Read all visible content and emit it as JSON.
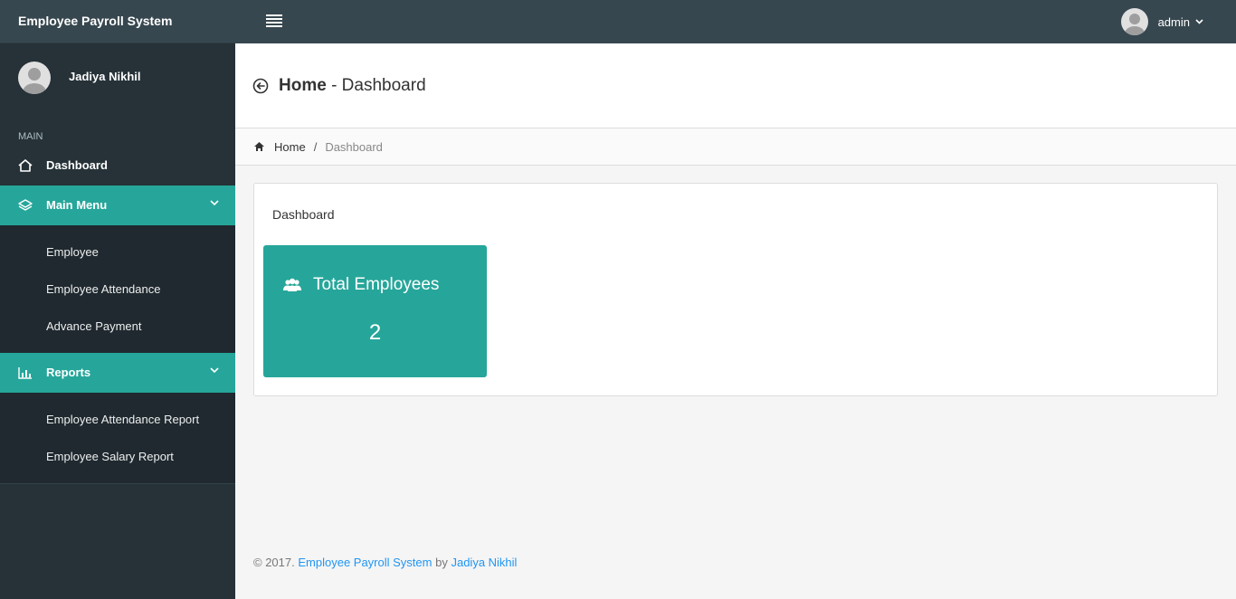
{
  "navbar": {
    "brand": "Employee Payroll System",
    "user_name": "admin"
  },
  "sidebar": {
    "user_name": "Jadiya Nikhil",
    "category": "MAIN",
    "dashboard": "Dashboard",
    "main_menu": {
      "label": "Main Menu",
      "items": [
        "Employee",
        "Employee Attendance",
        "Advance Payment"
      ]
    },
    "reports": {
      "label": "Reports",
      "items": [
        "Employee Attendance Report",
        "Employee Salary Report"
      ]
    }
  },
  "header": {
    "title": "Home",
    "subtitle": "- Dashboard"
  },
  "breadcrumb": {
    "home": "Home",
    "separator": "/",
    "current": "Dashboard"
  },
  "panel": {
    "title": "Dashboard",
    "stat": {
      "label": "Total Employees",
      "value": "2"
    }
  },
  "footer": {
    "copyright": "© 2017.",
    "app_link": "Employee Payroll System",
    "by": "by",
    "author_link": "Jadiya Nikhil"
  },
  "colors": {
    "navbar": "#37474f",
    "sidebar": "#263238",
    "accent": "#26a69a",
    "link": "#2196f3"
  }
}
